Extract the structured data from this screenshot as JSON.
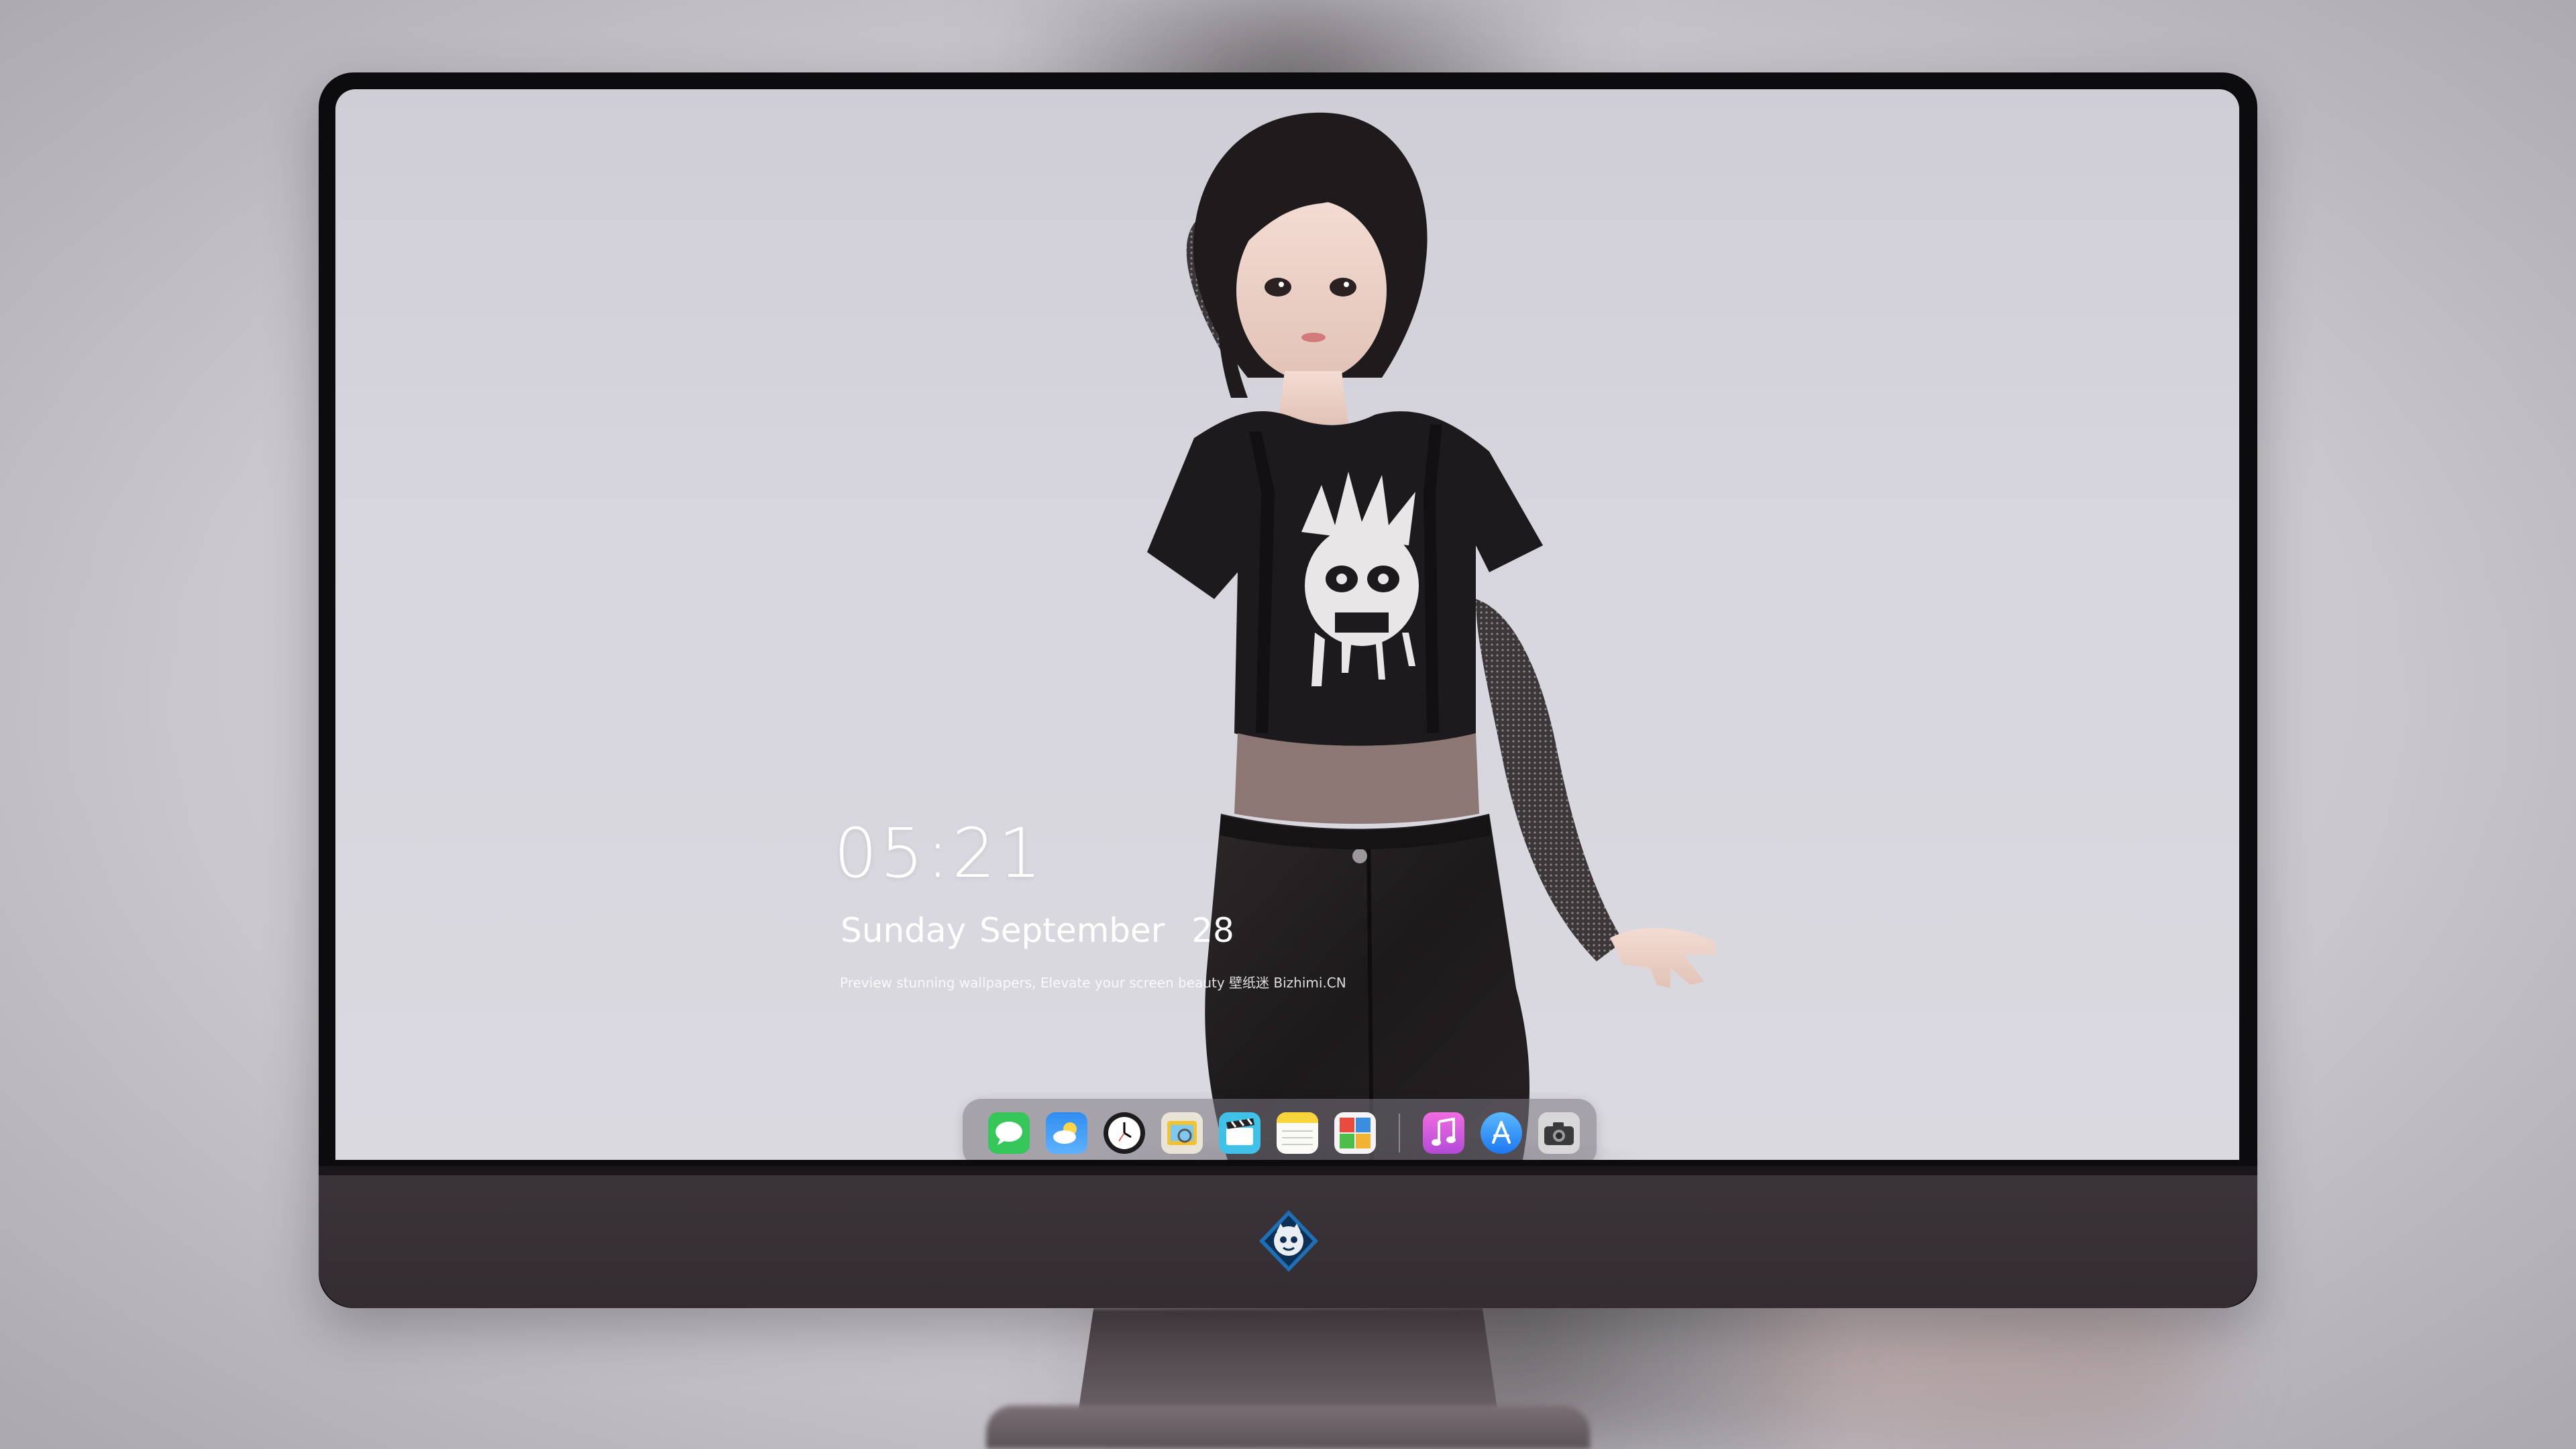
{
  "lockscreen": {
    "time": "05:21",
    "date": "Sunday September  28",
    "tagline": "Preview stunning wallpapers, Elevate your screen beauty  壁纸迷  Bizhimi.CN"
  },
  "dock": {
    "apps": [
      {
        "name": "messages-icon",
        "color": "#35c759"
      },
      {
        "name": "weather-icon",
        "color": "#2f8cf0"
      },
      {
        "name": "clock-icon",
        "color": "#1c1c1e"
      },
      {
        "name": "preview-icon",
        "color": "#f2c230"
      },
      {
        "name": "clips-icon",
        "color": "#3fc1e8"
      },
      {
        "name": "notes-icon",
        "color": "#f7d33c"
      },
      {
        "name": "photo-booth-icon",
        "color": "#e84a3c"
      },
      {
        "name": "music-icon",
        "color": "#e04fd2"
      },
      {
        "name": "app-store-icon",
        "color": "#2a8ff5"
      },
      {
        "name": "camera-icon",
        "color": "#6f6f73"
      }
    ]
  },
  "chin": {
    "logo": "mascot-logo-icon"
  }
}
